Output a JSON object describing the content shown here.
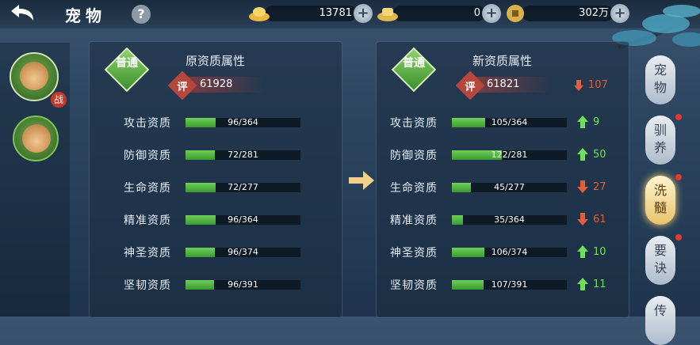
{
  "header": {
    "title": "宠物",
    "help_icon": "question-icon"
  },
  "resources": [
    {
      "name": "gold-ingot-icon",
      "value": "13781"
    },
    {
      "name": "silver-ingot-icon",
      "value": "0"
    },
    {
      "name": "coin-icon",
      "value": "302万"
    }
  ],
  "battle_badge": "战",
  "old_panel": {
    "quality": "普通",
    "title": "原资质属性",
    "score_label": "评",
    "score": "61928",
    "rows": [
      {
        "label": "攻击资质",
        "value": 96,
        "max": 364,
        "text": "96/364"
      },
      {
        "label": "防御资质",
        "value": 72,
        "max": 281,
        "text": "72/281"
      },
      {
        "label": "生命资质",
        "value": 72,
        "max": 277,
        "text": "72/277"
      },
      {
        "label": "精准资质",
        "value": 96,
        "max": 364,
        "text": "96/364"
      },
      {
        "label": "神圣资质",
        "value": 96,
        "max": 374,
        "text": "96/374"
      },
      {
        "label": "坚韧资质",
        "value": 96,
        "max": 391,
        "text": "96/391"
      }
    ]
  },
  "new_panel": {
    "quality": "普通",
    "title": "新资质属性",
    "score_label": "评",
    "score": "61821",
    "score_delta": {
      "dir": "down",
      "text": "107"
    },
    "rows": [
      {
        "label": "攻击资质",
        "value": 105,
        "max": 364,
        "text": "105/364",
        "delta": "9",
        "dir": "up"
      },
      {
        "label": "防御资质",
        "value": 122,
        "max": 281,
        "text": "122/281",
        "delta": "50",
        "dir": "up"
      },
      {
        "label": "生命资质",
        "value": 45,
        "max": 277,
        "text": "45/277",
        "delta": "27",
        "dir": "down"
      },
      {
        "label": "精准资质",
        "value": 35,
        "max": 364,
        "text": "35/364",
        "delta": "61",
        "dir": "down"
      },
      {
        "label": "神圣资质",
        "value": 106,
        "max": 374,
        "text": "106/374",
        "delta": "10",
        "dir": "up"
      },
      {
        "label": "坚韧资质",
        "value": 107,
        "max": 391,
        "text": "107/391",
        "delta": "11",
        "dir": "up"
      }
    ]
  },
  "tabs": [
    {
      "label": "宠物",
      "active": false,
      "dot": false
    },
    {
      "label": "驯养",
      "active": false,
      "dot": true
    },
    {
      "label": "洗髓",
      "active": true,
      "dot": true
    },
    {
      "label": "要诀",
      "active": false,
      "dot": true
    },
    {
      "label": "传",
      "active": false,
      "dot": false
    }
  ],
  "colors": {
    "up": "#6ee05a",
    "down": "#e25d3b",
    "bar_fill": "#4fb63f"
  }
}
